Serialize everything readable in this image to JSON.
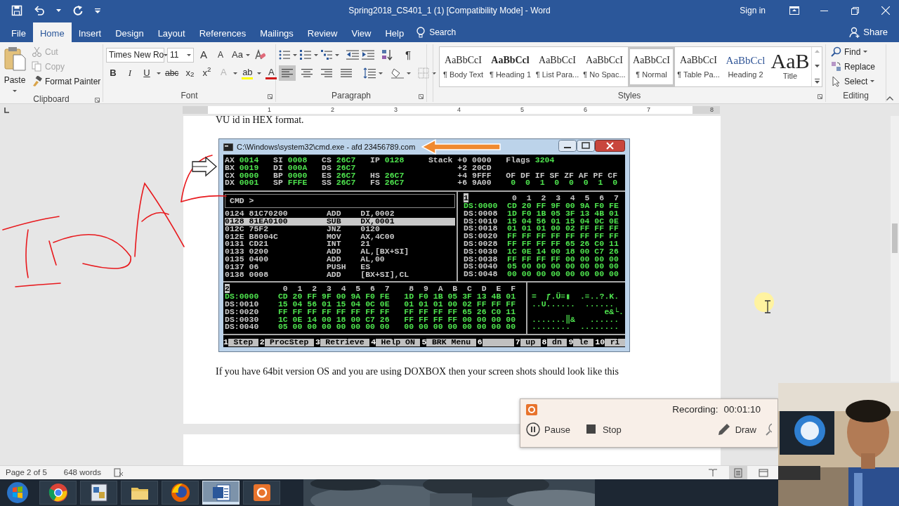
{
  "window": {
    "title": "Spring2018_CS401_1 (1) [Compatibility Mode] - Word",
    "sign_in": "Sign in"
  },
  "ribbon_tabs": [
    {
      "label": "File",
      "selected": false
    },
    {
      "label": "Home",
      "selected": true
    },
    {
      "label": "Insert",
      "selected": false
    },
    {
      "label": "Design",
      "selected": false
    },
    {
      "label": "Layout",
      "selected": false
    },
    {
      "label": "References",
      "selected": false
    },
    {
      "label": "Mailings",
      "selected": false
    },
    {
      "label": "Review",
      "selected": false
    },
    {
      "label": "View",
      "selected": false
    },
    {
      "label": "Help",
      "selected": false
    }
  ],
  "tell_me": {
    "placeholder": "Search"
  },
  "share": "Share",
  "clipboard": {
    "paste": "Paste",
    "group_label": "Clipboard",
    "commands": [
      {
        "label": "Cut",
        "kind": "cut",
        "disabled": true
      },
      {
        "label": "Copy",
        "kind": "copy",
        "disabled": true
      },
      {
        "label": "Format Painter",
        "kind": "painter",
        "disabled": false
      }
    ]
  },
  "font": {
    "group_label": "Font",
    "name": "Times New Ro",
    "size": "11",
    "grow": "A",
    "shrink": "A",
    "change_case": "Aa",
    "format_buttons": [
      {
        "label": "B",
        "kind": "bold"
      },
      {
        "label": "I",
        "kind": "italic"
      },
      {
        "label": "U",
        "kind": "underline"
      },
      {
        "label": "abc",
        "kind": "strike"
      },
      {
        "label": "x$_{2}$",
        "kind": "sub"
      },
      {
        "label": "x$^{2}$",
        "kind": "sup"
      }
    ],
    "effect_buttons": [
      {
        "label": "A",
        "kind": "effects",
        "disabled": true
      },
      {
        "label": "ab",
        "kind": "highlight",
        "disabled": false
      },
      {
        "label": "A",
        "kind": "color",
        "disabled": false
      }
    ]
  },
  "paragraph": {
    "group_label": "Paragraph",
    "show_marks": "¶",
    "alignment": [
      {
        "kind": "left",
        "selected": true
      },
      {
        "kind": "center",
        "selected": false
      },
      {
        "kind": "right",
        "selected": false
      },
      {
        "kind": "justify",
        "selected": false
      }
    ]
  },
  "styles": {
    "group_label": "Styles",
    "items": [
      {
        "preview": "AaBbCcI",
        "label": "¶ Body Text",
        "kind": "plain",
        "selected": false
      },
      {
        "preview": "AaBbCcl",
        "label": "¶ Heading 1",
        "kind": "bold",
        "selected": false
      },
      {
        "preview": "AaBbCcI",
        "label": "¶ List Para...",
        "kind": "plain",
        "selected": false
      },
      {
        "preview": "AaBbCcI",
        "label": "¶ No Spac...",
        "kind": "plain",
        "selected": false
      },
      {
        "preview": "AaBbCcI",
        "label": "¶ Normal",
        "kind": "plain",
        "selected": true
      },
      {
        "preview": "AaBbCcI",
        "label": "¶ Table Pa...",
        "kind": "plain",
        "selected": false
      },
      {
        "preview": "AaBbCcl",
        "label": "Heading 2",
        "kind": "blue",
        "selected": false
      },
      {
        "preview": "AaB",
        "label": "Title",
        "kind": "large",
        "selected": false
      }
    ]
  },
  "editing": {
    "group_label": "Editing",
    "commands": [
      {
        "label": "Find",
        "kind": "find"
      },
      {
        "label": "Replace",
        "kind": "replace"
      },
      {
        "label": "Select",
        "kind": "select"
      }
    ]
  },
  "ruler": [
    "1",
    "2",
    "3",
    "4",
    "5",
    "6",
    "7",
    "8"
  ],
  "document": {
    "cut_line": "VU id in HEX format.",
    "paragraph": "If you have 64bit version OS and you are using DOXBOX then your screen shots should look like this"
  },
  "cmd_window": {
    "title": "C:\\Windows\\system32\\cmd.exe - afd  23456789.com",
    "registers": [
      [
        {
          "text": "AX ",
          "kind": "label"
        },
        {
          "text": "0014",
          "kind": "value"
        },
        {
          "text": "   SI ",
          "kind": "label"
        },
        {
          "text": "0008",
          "kind": "value"
        },
        {
          "text": "   CS ",
          "kind": "label"
        },
        {
          "text": "26C7",
          "kind": "value"
        },
        {
          "text": "   IP ",
          "kind": "label"
        },
        {
          "text": "0128",
          "kind": "value"
        },
        {
          "text": "     Stack +0 0000   Flags ",
          "kind": "label"
        },
        {
          "text": "3204",
          "kind": "value"
        }
      ],
      [
        {
          "text": "BX ",
          "kind": "label"
        },
        {
          "text": "0019",
          "kind": "value"
        },
        {
          "text": "   DI ",
          "kind": "label"
        },
        {
          "text": "000A",
          "kind": "value"
        },
        {
          "text": "   DS ",
          "kind": "label"
        },
        {
          "text": "26C7",
          "kind": "value"
        },
        {
          "text": "                     +2 20CD",
          "kind": "label"
        }
      ],
      [
        {
          "text": "CX ",
          "kind": "label"
        },
        {
          "text": "0000",
          "kind": "value"
        },
        {
          "text": "   BP ",
          "kind": "label"
        },
        {
          "text": "0000",
          "kind": "value"
        },
        {
          "text": "   ES ",
          "kind": "label"
        },
        {
          "text": "26C7",
          "kind": "value"
        },
        {
          "text": "   HS ",
          "kind": "label"
        },
        {
          "text": "26C7",
          "kind": "value"
        },
        {
          "text": "           +4 9FFF   OF DF IF SF ZF AF PF CF",
          "kind": "label"
        }
      ],
      [
        {
          "text": "DX ",
          "kind": "label"
        },
        {
          "text": "0001",
          "kind": "value"
        },
        {
          "text": "   SP ",
          "kind": "label"
        },
        {
          "text": "FFFE",
          "kind": "value"
        },
        {
          "text": "   SS ",
          "kind": "label"
        },
        {
          "text": "26C7",
          "kind": "value"
        },
        {
          "text": "   FS ",
          "kind": "label"
        },
        {
          "text": "26C7",
          "kind": "value"
        },
        {
          "text": "           +6 9A00    ",
          "kind": "label"
        },
        {
          "text": "0  0  1  0  0  0  1  0",
          "kind": "value"
        }
      ]
    ],
    "prompt": "CMD >",
    "disassembly": [
      {
        "text": "0124 81C70200        ADD    DI,0002",
        "selected": false
      },
      {
        "text": "0128 81EA0100        SUB    DX,0001",
        "selected": true
      },
      {
        "text": "012C 75F2            JNZ    0120",
        "selected": false
      },
      {
        "text": "012E B8004C          MOV    AX,4C00",
        "selected": false
      },
      {
        "text": "0131 CD21            INT    21",
        "selected": false
      },
      {
        "text": "0133 0200            ADD    AL,[BX+SI]",
        "selected": false
      },
      {
        "text": "0135 0400            ADD    AL,00",
        "selected": false
      },
      {
        "text": "0137 06              PUSH   ES",
        "selected": false
      },
      {
        "text": "0138 0008            ADD    [BX+SI],CL",
        "selected": false
      }
    ],
    "dump_1": {
      "pane": "1",
      "columns": "0  1  2  3  4  5  6  7",
      "rows": [
        {
          "address": "DS:0000",
          "bytes": "CD 20 FF 9F 00 9A F0 FE",
          "current": true
        },
        {
          "address": "DS:0008",
          "bytes": "1D F0 1B 05 3F 13 4B 01",
          "current": false
        },
        {
          "address": "DS:0010",
          "bytes": "15 04 56 01 15 04 0C 0E",
          "current": false
        },
        {
          "address": "DS:0018",
          "bytes": "01 01 01 00 02 FF FF FF",
          "current": false
        },
        {
          "address": "DS:0020",
          "bytes": "FF FF FF FF FF FF FF FF",
          "current": false
        },
        {
          "address": "DS:0028",
          "bytes": "FF FF FF FF 65 26 C0 11",
          "current": false
        },
        {
          "address": "DS:0030",
          "bytes": "1C 0E 14 00 18 00 C7 26",
          "current": false
        },
        {
          "address": "DS:0038",
          "bytes": "FF FF FF FF 00 00 00 00",
          "current": false
        },
        {
          "address": "DS:0040",
          "bytes": "05 00 00 00 00 00 00 00",
          "current": false
        },
        {
          "address": "DS:0048",
          "bytes": "00 00 00 00 00 00 00 00",
          "current": false
        }
      ]
    },
    "dump_2": {
      "pane": "2",
      "columns": "0  1  2  3  4  5  6  7    8  9  A  B  C  D  E  F",
      "rows": [
        {
          "address": "DS:0000",
          "bytes": "CD 20 FF 9F 00 9A F0 FE   1D F0 1B 05 3F 13 4B 01",
          "current": true
        },
        {
          "address": "DS:0010",
          "bytes": "15 04 56 01 15 04 0C 0E   01 01 01 00 02 FF FF FF",
          "current": false
        },
        {
          "address": "DS:0020",
          "bytes": "FF FF FF FF FF FF FF FF   FF FF FF FF 65 26 C0 11",
          "current": false
        },
        {
          "address": "DS:0030",
          "bytes": "1C 0E 14 00 18 00 C7 26   FF FF FF FF 00 00 00 00",
          "current": false
        },
        {
          "address": "DS:0040",
          "bytes": "05 00 00 00 00 00 00 00   00 00 00 00 00 00 00 00",
          "current": false
        }
      ],
      "ascii": [
        "=  ƒ.Ü≡▮  .≡..?.K.",
        "..U......  ......",
        "               e&└.",
        ".......‖&   ......",
        "........  ........"
      ]
    },
    "function_keys": [
      {
        "number": "1",
        "label": "Step"
      },
      {
        "number": "2",
        "label": "ProcStep"
      },
      {
        "number": "3",
        "label": "Retrieve"
      },
      {
        "number": "4",
        "label": "Help ON"
      },
      {
        "number": "5",
        "label": "BRK Menu"
      },
      {
        "number": "6"
      },
      {
        "number": "7",
        "label": "up"
      },
      {
        "number": "8",
        "label": "dn"
      },
      {
        "number": "9",
        "label": "le"
      },
      {
        "number": "10",
        "label": "ri"
      }
    ]
  },
  "status_bar": {
    "page": "Page 2 of 5",
    "words": "648 words",
    "views": [
      {
        "kind": "read",
        "selected": false
      },
      {
        "kind": "print",
        "selected": true
      },
      {
        "kind": "web",
        "selected": false
      }
    ]
  },
  "recorder": {
    "label": "Recording:",
    "time": "00:01:10",
    "buttons": [
      {
        "label": "Pause",
        "kind": "pause"
      },
      {
        "label": "Stop",
        "kind": "stop"
      },
      {
        "label": "Draw",
        "kind": "draw"
      }
    ]
  },
  "taskbar": [
    {
      "kind": "start"
    },
    {
      "kind": "chrome",
      "active": false
    },
    {
      "kind": "app",
      "active": false
    },
    {
      "kind": "folder",
      "active": false
    },
    {
      "kind": "firefox",
      "active": false
    },
    {
      "kind": "word",
      "active": true
    },
    {
      "kind": "recorder",
      "active": false
    }
  ]
}
